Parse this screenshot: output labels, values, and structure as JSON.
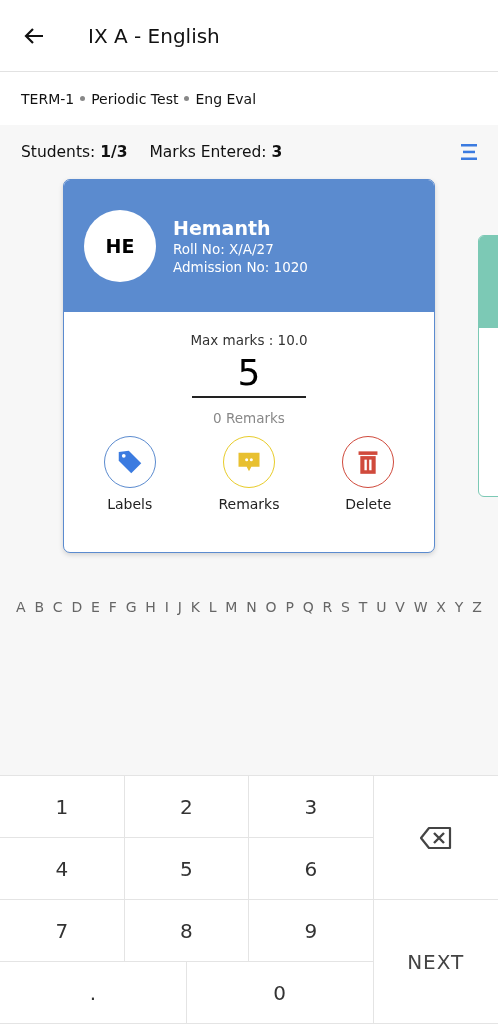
{
  "header": {
    "title": "IX A - English"
  },
  "breadcrumb": [
    "TERM-1",
    "Periodic Test",
    "Eng Eval"
  ],
  "stats": {
    "students": "Students: **1/3**",
    "marks_entered": "Marks Entered: **3**"
  },
  "card": {
    "initials": "HE",
    "name": "Hemanth",
    "roll": "Roll No: X/A/27",
    "admission": "Admission No: 1020",
    "max_marks": "Max marks : 10.0",
    "mark": "5",
    "remarks_count": "0 Remarks",
    "actions": [
      {
        "kind": "labels",
        "label": "Labels"
      },
      {
        "kind": "remarks",
        "label": "Remarks"
      },
      {
        "kind": "delete",
        "label": "Delete"
      }
    ]
  },
  "alphabet": [
    "A",
    "B",
    "C",
    "D",
    "E",
    "F",
    "G",
    "H",
    "I",
    "J",
    "K",
    "L",
    "M",
    "N",
    "O",
    "P",
    "Q",
    "R",
    "S",
    "T",
    "U",
    "V",
    "W",
    "X",
    "Y",
    "Z"
  ],
  "keypad": {
    "keys": [
      {
        "kind": "digit",
        "label": "1"
      },
      {
        "kind": "digit",
        "label": "2"
      },
      {
        "kind": "digit",
        "label": "3"
      },
      {
        "kind": "digit",
        "label": "4"
      },
      {
        "kind": "digit",
        "label": "5"
      },
      {
        "kind": "digit",
        "label": "6"
      },
      {
        "kind": "digit",
        "label": "7"
      },
      {
        "kind": "digit",
        "label": "8"
      },
      {
        "kind": "digit",
        "label": "9"
      },
      {
        "kind": "wide",
        "label": "."
      },
      {
        "kind": "wide",
        "label": "0"
      }
    ],
    "next": "NEXT"
  }
}
